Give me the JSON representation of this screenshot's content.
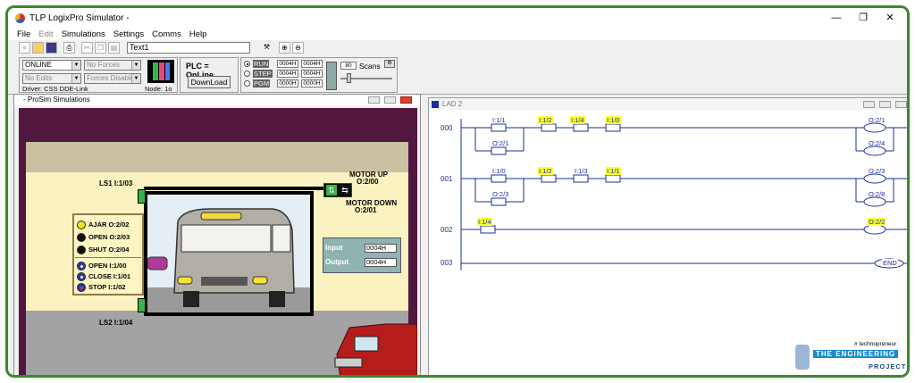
{
  "app": {
    "title": "TLP LogixPro Simulator  -",
    "window_controls": [
      "—",
      "❐",
      "✕"
    ]
  },
  "menu": [
    {
      "label": "File",
      "enabled": true
    },
    {
      "label": "Edit",
      "enabled": false
    },
    {
      "label": "Simulations",
      "enabled": true
    },
    {
      "label": "Settings",
      "enabled": true
    },
    {
      "label": "Comms",
      "enabled": true
    },
    {
      "label": "Help",
      "enabled": true
    }
  ],
  "toolbar": {
    "document_name": "Text1"
  },
  "control_panel": {
    "mode_select": "ONLINE",
    "forces_select": "No Forces",
    "edits_select": "No Edits",
    "forces_disabled_select": "Forces Disabled",
    "driver": "Driver: CSS DDE-Link",
    "node": "Node: 1o",
    "plc_status": "PLC = OnLine",
    "download_label": "DownLoad",
    "modes": [
      "RUN",
      "STEP",
      "PGM"
    ],
    "hex_values": [
      "0004H",
      "0004H",
      "0004H",
      "0004H",
      "0000H",
      "0000H"
    ],
    "scans_value": "80",
    "scans_label": "Scans"
  },
  "left_window": {
    "title": "- ProSim Simulations",
    "labels": {
      "ls1": "LS1  I:1/03",
      "ls2": "LS2  I:1/04",
      "motor_up": "MOTOR UP",
      "motor_up_addr": "O:2/00",
      "motor_down": "MOTOR DOWN",
      "motor_down_addr": "O:2/01"
    },
    "indicators": [
      {
        "label": "AJAR O:2/02",
        "color": "#f2e21c"
      },
      {
        "label": "OPEN O:2/03",
        "color": "#111111"
      },
      {
        "label": "SHUT O:2/04",
        "color": "#111111"
      }
    ],
    "pushbuttons": [
      {
        "label": "OPEN   I:1/00"
      },
      {
        "label": "CLOSE I:1/01"
      },
      {
        "label": "STOP   I:1/02"
      }
    ],
    "io": {
      "input_label": "Input",
      "input_value": "0004H",
      "output_label": "Output",
      "output_value": "0004H"
    }
  },
  "lad_window": {
    "title": "LAD 2",
    "rungs": [
      {
        "number": "000",
        "contacts": [
          {
            "addr": "I:1/1",
            "hl": false
          },
          {
            "addr": "I:1/2",
            "hl": true
          },
          {
            "addr": "I:1/4",
            "hl": true
          },
          {
            "addr": "I:1/0",
            "hl": true
          }
        ],
        "branch": "O:2/1",
        "coils": [
          {
            "addr": "O:2/1",
            "hl": false
          },
          {
            "addr": "O:2/4",
            "hl": false
          }
        ]
      },
      {
        "number": "001",
        "contacts": [
          {
            "addr": "I:1/0",
            "hl": false
          },
          {
            "addr": "I:1/2",
            "hl": true
          },
          {
            "addr": "I:1/3",
            "hl": false
          },
          {
            "addr": "I:1/1",
            "hl": true
          }
        ],
        "branch": "O:2/3",
        "coils": [
          {
            "addr": "O:2/3",
            "hl": false
          },
          {
            "addr": "O:2/8",
            "hl": false
          }
        ]
      },
      {
        "number": "002",
        "contacts": [
          {
            "addr": "I:1/4",
            "hl": true
          }
        ],
        "branch": "",
        "coils": [
          {
            "addr": "O:2/2",
            "hl": true
          }
        ]
      },
      {
        "number": "003",
        "contacts": [],
        "branch": "",
        "coils": [
          {
            "addr": "END",
            "hl": false
          }
        ]
      }
    ]
  },
  "watermark": {
    "tagline": "# technopreneur",
    "line1": "THE ENGINEERING",
    "line2": "PROJECTS"
  },
  "colors": {
    "frame": "#3a8a2a",
    "ladder_blue": "#1a2f9a",
    "highlight": "#ffff33",
    "sim_background": "#52173f",
    "sensor_green": "#38b34a"
  }
}
